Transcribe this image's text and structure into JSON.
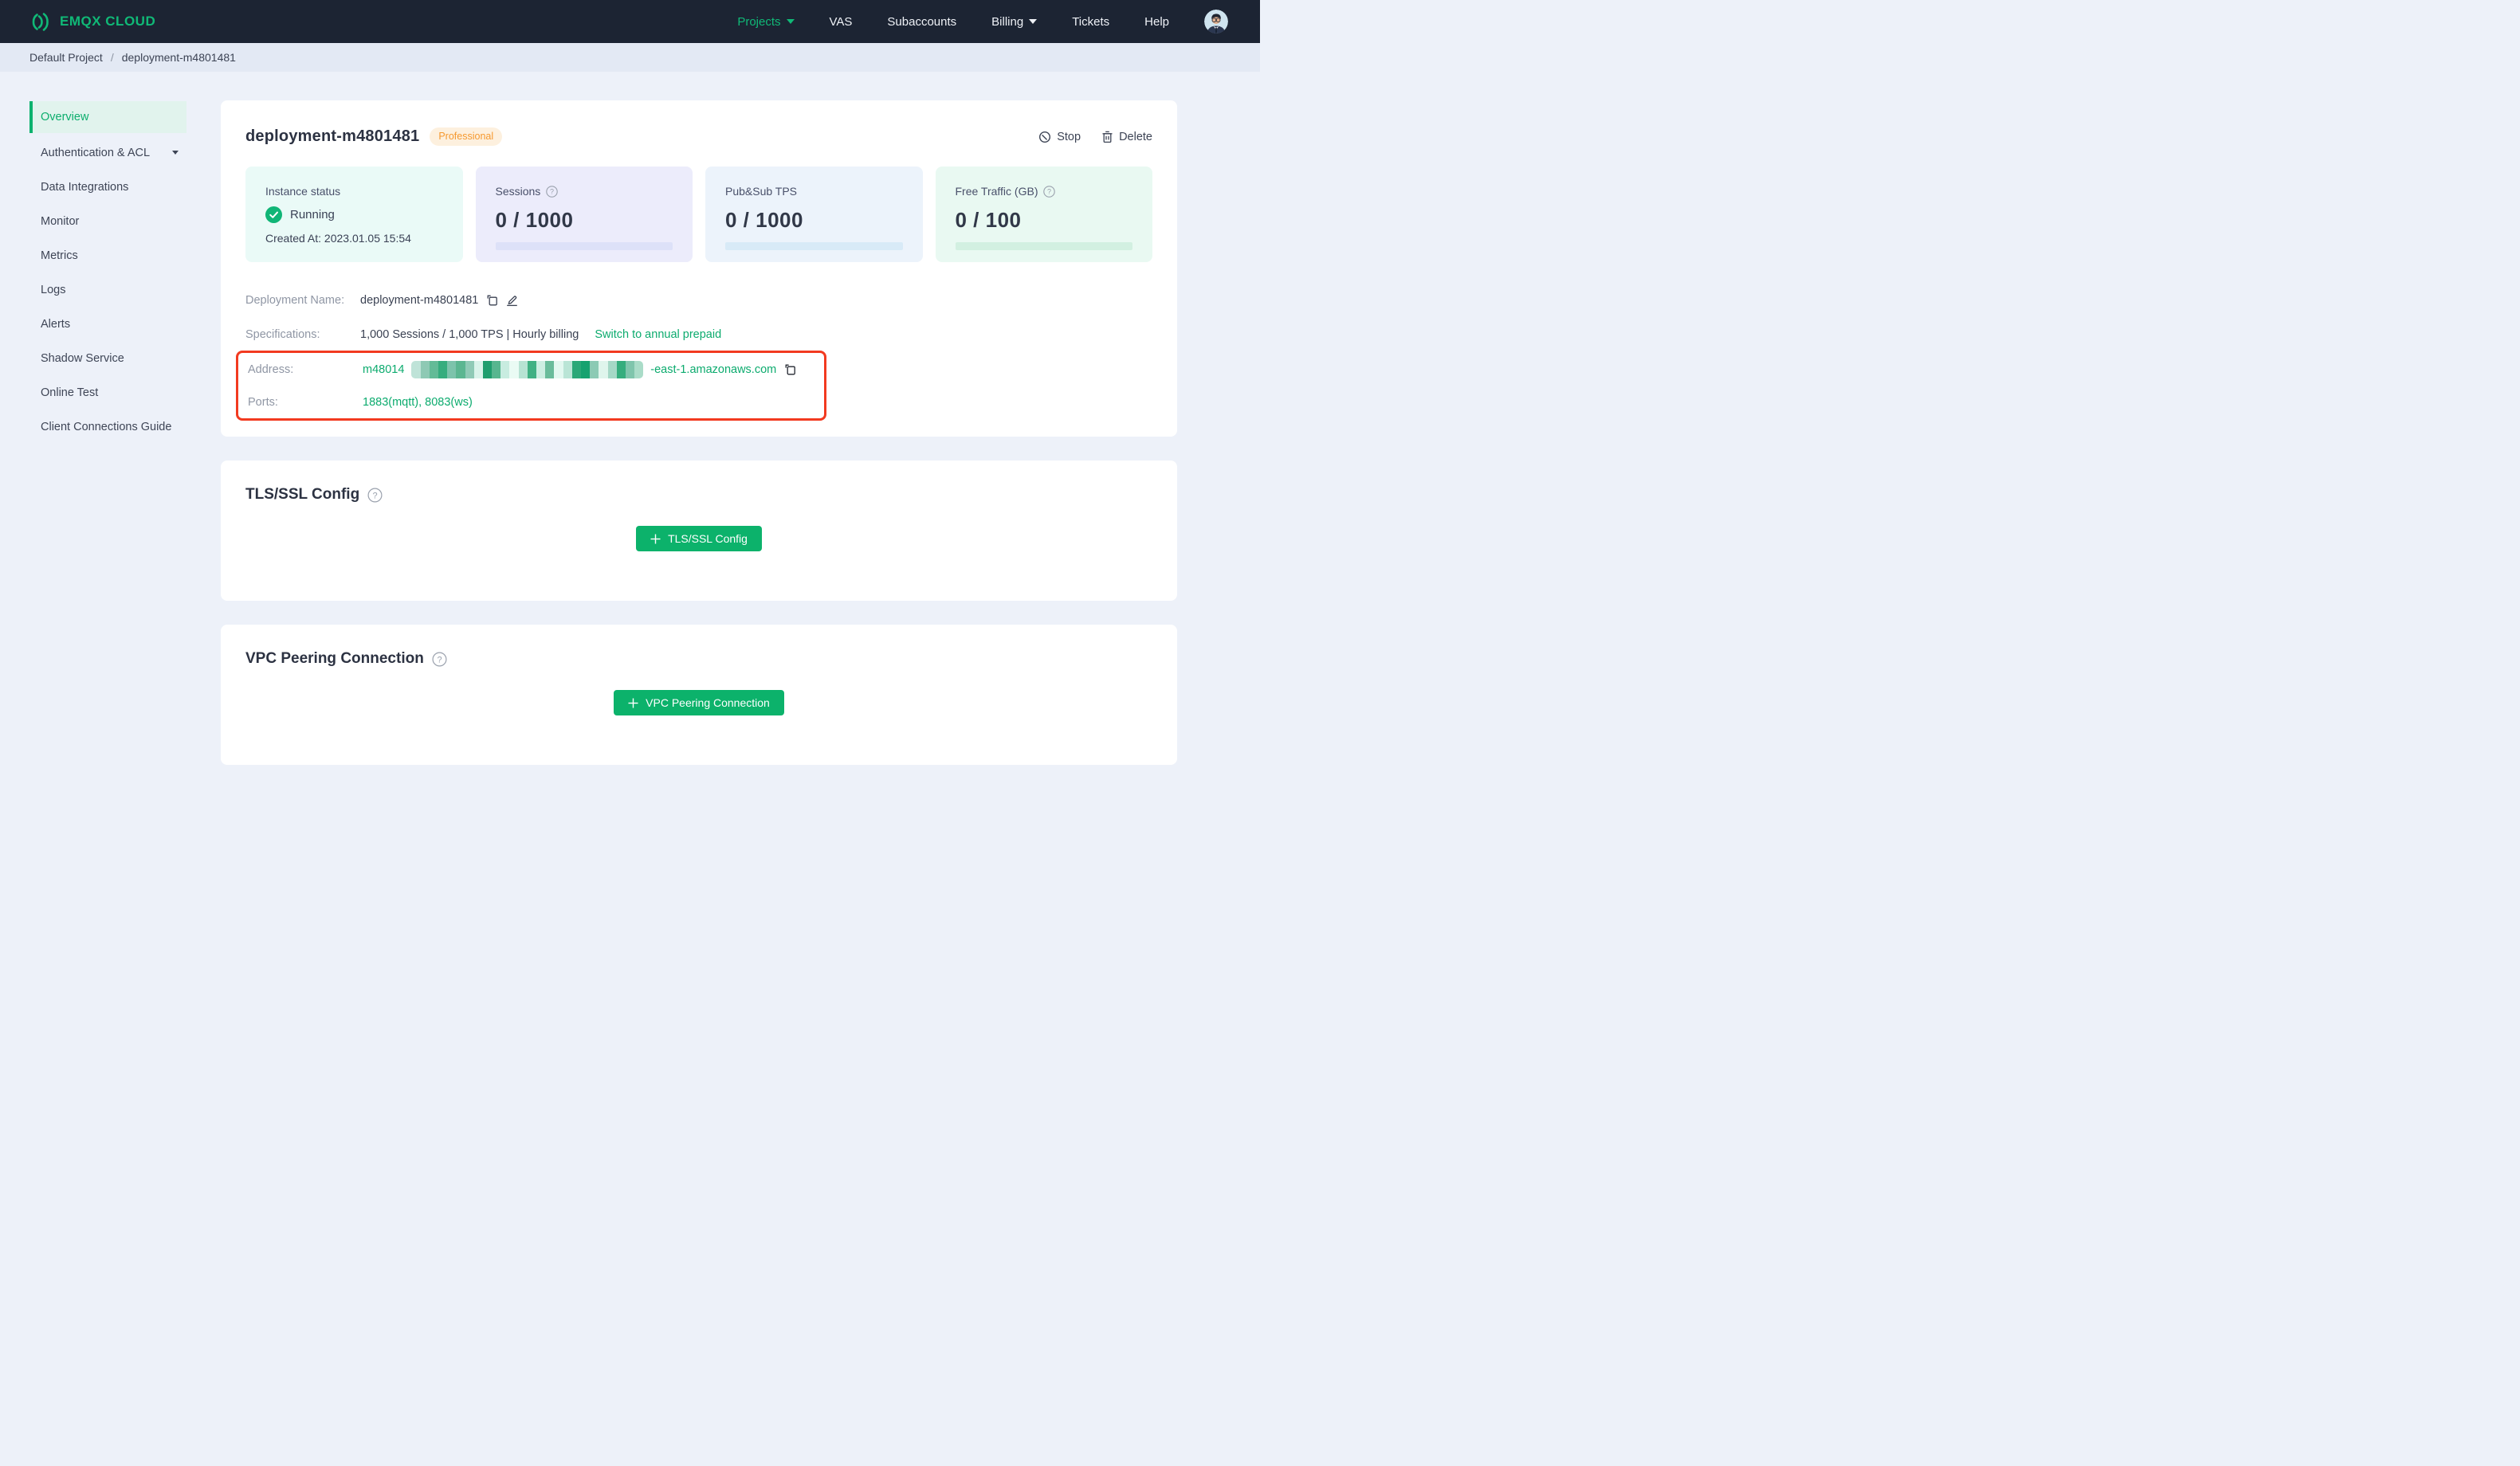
{
  "brand": {
    "name": "EMQX CLOUD",
    "color": "#10b977"
  },
  "navbar": {
    "items": [
      {
        "label": "Projects",
        "active": true,
        "caret": true
      },
      {
        "label": "VAS"
      },
      {
        "label": "Subaccounts"
      },
      {
        "label": "Billing",
        "caret": true
      },
      {
        "label": "Tickets"
      },
      {
        "label": "Help"
      }
    ]
  },
  "breadcrumb": {
    "project": "Default Project",
    "separator": "/",
    "deployment": "deployment-m4801481"
  },
  "sidebar": {
    "items": [
      {
        "label": "Overview",
        "active": true
      },
      {
        "label": "Authentication & ACL",
        "caret": true
      },
      {
        "label": "Data Integrations"
      },
      {
        "label": "Monitor"
      },
      {
        "label": "Metrics"
      },
      {
        "label": "Logs"
      },
      {
        "label": "Alerts"
      },
      {
        "label": "Shadow Service"
      },
      {
        "label": "Online Test"
      },
      {
        "label": "Client Connections Guide"
      }
    ]
  },
  "deployment": {
    "title": "deployment-m4801481",
    "badge": "Professional",
    "actions": {
      "stop_label": "Stop",
      "delete_label": "Delete"
    },
    "stats": [
      {
        "label": "Instance status",
        "status": "Running",
        "created": "Created At: 2023.01.05 15:54"
      },
      {
        "label": "Sessions",
        "value": "0 / 1000",
        "help": true
      },
      {
        "label": "Pub&Sub TPS",
        "value": "0 / 1000"
      },
      {
        "label": "Free Traffic (GB)",
        "value": "0 / 100",
        "help": true
      }
    ],
    "rows": {
      "deployment_name": {
        "label": "Deployment Name:",
        "value": "deployment-m4801481"
      },
      "specifications": {
        "label": "Specifications:",
        "value": "1,000 Sessions / 1,000 TPS | Hourly billing",
        "link": "Switch to annual prepaid"
      },
      "address": {
        "label": "Address:",
        "prefix": "m48014",
        "suffix": "-east-1.amazonaws.com",
        "redaction_blocks": [
          "#bfe3d8",
          "#8ec9b4",
          "#63bb97",
          "#36ad7e",
          "#7cc3ab",
          "#5bb691",
          "#8fcab6",
          "#d9f3ea",
          "#1f9e6e",
          "#57b68f",
          "#c8ece0",
          "#eafbf4",
          "#b7e3d3",
          "#41b184",
          "#cdeee2",
          "#6abc9b",
          "#e3f8f0",
          "#bae5d6",
          "#2aa878",
          "#16a26f",
          "#8ccab4",
          "#dff5ec",
          "#a5d8c6",
          "#35ad7d",
          "#7fc5ac",
          "#aadcc8"
        ]
      },
      "ports": {
        "label": "Ports:",
        "value": "1883(mqtt), 8083(ws)"
      }
    }
  },
  "sections": [
    {
      "title": "TLS/SSL Config",
      "button_label": "TLS/SSL Config",
      "help": true
    },
    {
      "title": "VPC Peering Connection",
      "button_label": "VPC Peering Connection",
      "help": true
    }
  ],
  "colors": {
    "navbar_bg": "#1c2433",
    "page_bg": "#edf1f9",
    "brand_green": "#10b977",
    "button_green": "#0cb26b",
    "link_green": "#0cab6e",
    "annotation_red": "#f23a20",
    "badge_orange_text": "#f6992f",
    "badge_orange_bg": "#fdf0de",
    "status_card_bg": "#eafaf7",
    "sessions_card_bg": "#ececfb",
    "tps_card_bg": "#ecf3fb",
    "traffic_card_bg": "#e9f9f2"
  }
}
